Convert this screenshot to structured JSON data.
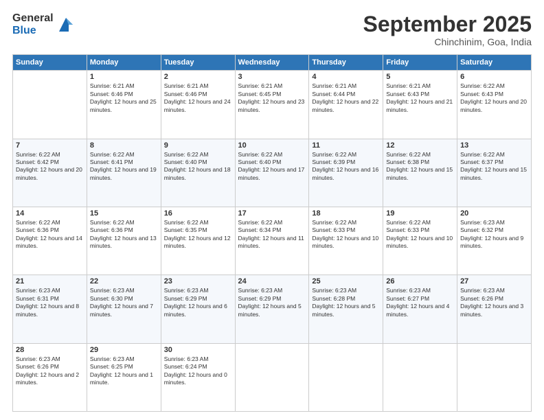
{
  "header": {
    "logo_general": "General",
    "logo_blue": "Blue",
    "month_title": "September 2025",
    "location": "Chinchinim, Goa, India"
  },
  "weekdays": [
    "Sunday",
    "Monday",
    "Tuesday",
    "Wednesday",
    "Thursday",
    "Friday",
    "Saturday"
  ],
  "weeks": [
    [
      {
        "day": "",
        "sunrise": "",
        "sunset": "",
        "daylight": ""
      },
      {
        "day": "1",
        "sunrise": "Sunrise: 6:21 AM",
        "sunset": "Sunset: 6:46 PM",
        "daylight": "Daylight: 12 hours and 25 minutes."
      },
      {
        "day": "2",
        "sunrise": "Sunrise: 6:21 AM",
        "sunset": "Sunset: 6:46 PM",
        "daylight": "Daylight: 12 hours and 24 minutes."
      },
      {
        "day": "3",
        "sunrise": "Sunrise: 6:21 AM",
        "sunset": "Sunset: 6:45 PM",
        "daylight": "Daylight: 12 hours and 23 minutes."
      },
      {
        "day": "4",
        "sunrise": "Sunrise: 6:21 AM",
        "sunset": "Sunset: 6:44 PM",
        "daylight": "Daylight: 12 hours and 22 minutes."
      },
      {
        "day": "5",
        "sunrise": "Sunrise: 6:21 AM",
        "sunset": "Sunset: 6:43 PM",
        "daylight": "Daylight: 12 hours and 21 minutes."
      },
      {
        "day": "6",
        "sunrise": "Sunrise: 6:22 AM",
        "sunset": "Sunset: 6:43 PM",
        "daylight": "Daylight: 12 hours and 20 minutes."
      }
    ],
    [
      {
        "day": "7",
        "sunrise": "Sunrise: 6:22 AM",
        "sunset": "Sunset: 6:42 PM",
        "daylight": "Daylight: 12 hours and 20 minutes."
      },
      {
        "day": "8",
        "sunrise": "Sunrise: 6:22 AM",
        "sunset": "Sunset: 6:41 PM",
        "daylight": "Daylight: 12 hours and 19 minutes."
      },
      {
        "day": "9",
        "sunrise": "Sunrise: 6:22 AM",
        "sunset": "Sunset: 6:40 PM",
        "daylight": "Daylight: 12 hours and 18 minutes."
      },
      {
        "day": "10",
        "sunrise": "Sunrise: 6:22 AM",
        "sunset": "Sunset: 6:40 PM",
        "daylight": "Daylight: 12 hours and 17 minutes."
      },
      {
        "day": "11",
        "sunrise": "Sunrise: 6:22 AM",
        "sunset": "Sunset: 6:39 PM",
        "daylight": "Daylight: 12 hours and 16 minutes."
      },
      {
        "day": "12",
        "sunrise": "Sunrise: 6:22 AM",
        "sunset": "Sunset: 6:38 PM",
        "daylight": "Daylight: 12 hours and 15 minutes."
      },
      {
        "day": "13",
        "sunrise": "Sunrise: 6:22 AM",
        "sunset": "Sunset: 6:37 PM",
        "daylight": "Daylight: 12 hours and 15 minutes."
      }
    ],
    [
      {
        "day": "14",
        "sunrise": "Sunrise: 6:22 AM",
        "sunset": "Sunset: 6:36 PM",
        "daylight": "Daylight: 12 hours and 14 minutes."
      },
      {
        "day": "15",
        "sunrise": "Sunrise: 6:22 AM",
        "sunset": "Sunset: 6:36 PM",
        "daylight": "Daylight: 12 hours and 13 minutes."
      },
      {
        "day": "16",
        "sunrise": "Sunrise: 6:22 AM",
        "sunset": "Sunset: 6:35 PM",
        "daylight": "Daylight: 12 hours and 12 minutes."
      },
      {
        "day": "17",
        "sunrise": "Sunrise: 6:22 AM",
        "sunset": "Sunset: 6:34 PM",
        "daylight": "Daylight: 12 hours and 11 minutes."
      },
      {
        "day": "18",
        "sunrise": "Sunrise: 6:22 AM",
        "sunset": "Sunset: 6:33 PM",
        "daylight": "Daylight: 12 hours and 10 minutes."
      },
      {
        "day": "19",
        "sunrise": "Sunrise: 6:22 AM",
        "sunset": "Sunset: 6:33 PM",
        "daylight": "Daylight: 12 hours and 10 minutes."
      },
      {
        "day": "20",
        "sunrise": "Sunrise: 6:23 AM",
        "sunset": "Sunset: 6:32 PM",
        "daylight": "Daylight: 12 hours and 9 minutes."
      }
    ],
    [
      {
        "day": "21",
        "sunrise": "Sunrise: 6:23 AM",
        "sunset": "Sunset: 6:31 PM",
        "daylight": "Daylight: 12 hours and 8 minutes."
      },
      {
        "day": "22",
        "sunrise": "Sunrise: 6:23 AM",
        "sunset": "Sunset: 6:30 PM",
        "daylight": "Daylight: 12 hours and 7 minutes."
      },
      {
        "day": "23",
        "sunrise": "Sunrise: 6:23 AM",
        "sunset": "Sunset: 6:29 PM",
        "daylight": "Daylight: 12 hours and 6 minutes."
      },
      {
        "day": "24",
        "sunrise": "Sunrise: 6:23 AM",
        "sunset": "Sunset: 6:29 PM",
        "daylight": "Daylight: 12 hours and 5 minutes."
      },
      {
        "day": "25",
        "sunrise": "Sunrise: 6:23 AM",
        "sunset": "Sunset: 6:28 PM",
        "daylight": "Daylight: 12 hours and 5 minutes."
      },
      {
        "day": "26",
        "sunrise": "Sunrise: 6:23 AM",
        "sunset": "Sunset: 6:27 PM",
        "daylight": "Daylight: 12 hours and 4 minutes."
      },
      {
        "day": "27",
        "sunrise": "Sunrise: 6:23 AM",
        "sunset": "Sunset: 6:26 PM",
        "daylight": "Daylight: 12 hours and 3 minutes."
      }
    ],
    [
      {
        "day": "28",
        "sunrise": "Sunrise: 6:23 AM",
        "sunset": "Sunset: 6:26 PM",
        "daylight": "Daylight: 12 hours and 2 minutes."
      },
      {
        "day": "29",
        "sunrise": "Sunrise: 6:23 AM",
        "sunset": "Sunset: 6:25 PM",
        "daylight": "Daylight: 12 hours and 1 minute."
      },
      {
        "day": "30",
        "sunrise": "Sunrise: 6:23 AM",
        "sunset": "Sunset: 6:24 PM",
        "daylight": "Daylight: 12 hours and 0 minutes."
      },
      {
        "day": "",
        "sunrise": "",
        "sunset": "",
        "daylight": ""
      },
      {
        "day": "",
        "sunrise": "",
        "sunset": "",
        "daylight": ""
      },
      {
        "day": "",
        "sunrise": "",
        "sunset": "",
        "daylight": ""
      },
      {
        "day": "",
        "sunrise": "",
        "sunset": "",
        "daylight": ""
      }
    ]
  ]
}
